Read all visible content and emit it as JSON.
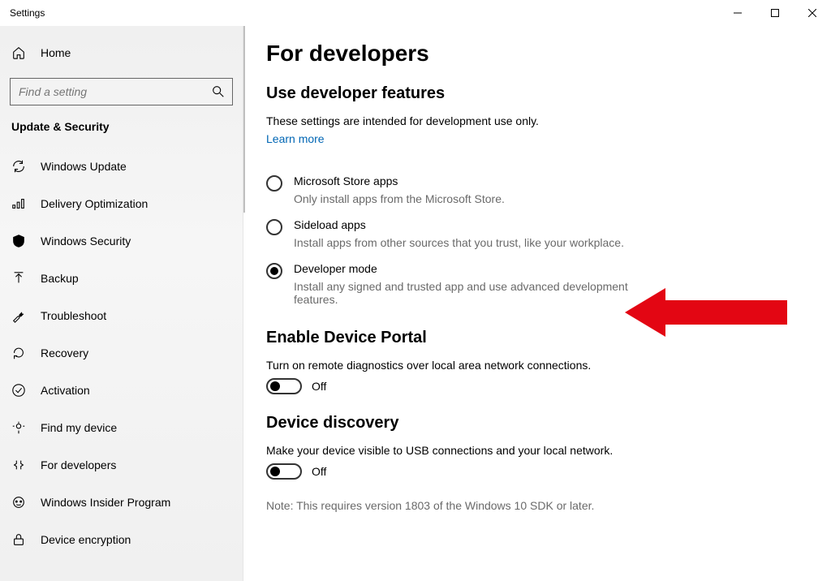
{
  "window": {
    "title": "Settings"
  },
  "sidebar": {
    "home": "Home",
    "search_placeholder": "Find a setting",
    "section": "Update & Security",
    "items": [
      {
        "label": "Windows Update"
      },
      {
        "label": "Delivery Optimization"
      },
      {
        "label": "Windows Security"
      },
      {
        "label": "Backup"
      },
      {
        "label": "Troubleshoot"
      },
      {
        "label": "Recovery"
      },
      {
        "label": "Activation"
      },
      {
        "label": "Find my device"
      },
      {
        "label": "For developers"
      },
      {
        "label": "Windows Insider Program"
      },
      {
        "label": "Device encryption"
      }
    ]
  },
  "main": {
    "heading": "For developers",
    "section1": {
      "title": "Use developer features",
      "desc": "These settings are intended for development use only.",
      "learn_more": "Learn more",
      "options": [
        {
          "label": "Microsoft Store apps",
          "sub": "Only install apps from the Microsoft Store.",
          "selected": false
        },
        {
          "label": "Sideload apps",
          "sub": "Install apps from other sources that you trust, like your workplace.",
          "selected": false
        },
        {
          "label": "Developer mode",
          "sub": "Install any signed and trusted app and use advanced development features.",
          "selected": true
        }
      ]
    },
    "section2": {
      "title": "Enable Device Portal",
      "desc": "Turn on remote diagnostics over local area network connections.",
      "toggle_state": "Off"
    },
    "section3": {
      "title": "Device discovery",
      "desc": "Make your device visible to USB connections and your local network.",
      "toggle_state": "Off",
      "note": "Note: This requires version 1803 of the Windows 10 SDK or later."
    }
  }
}
